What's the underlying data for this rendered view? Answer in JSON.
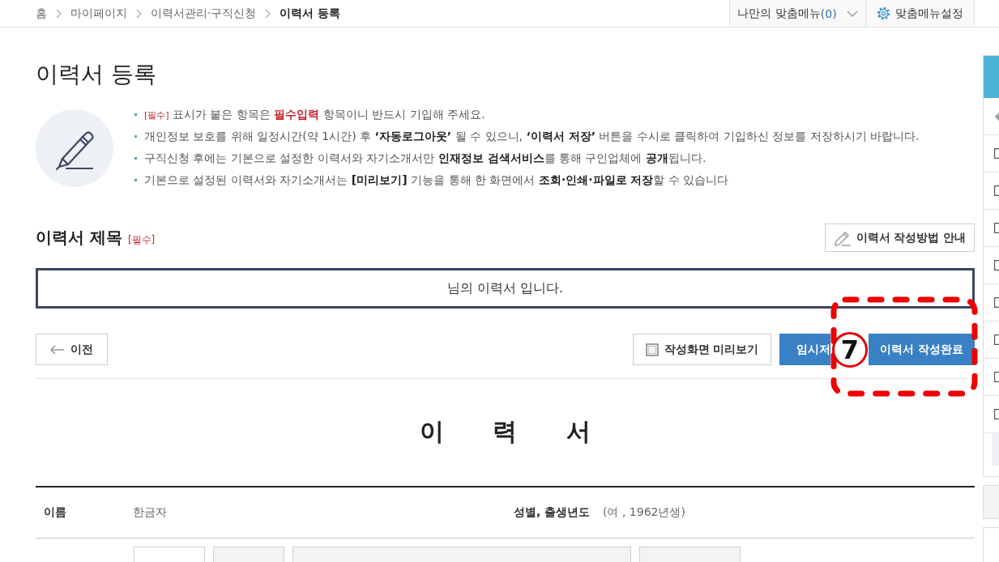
{
  "breadcrumb": [
    {
      "label": "홈",
      "current": false
    },
    {
      "label": "마이페이지",
      "current": false
    },
    {
      "label": "이력서관리·구직신청",
      "current": false
    },
    {
      "label": "이력서 등록",
      "current": true
    }
  ],
  "top_menu": {
    "my_menu": {
      "label": "나만의 맞춤메뉴",
      "count": "(0)"
    },
    "settings": "맞춤메뉴설정"
  },
  "page_title": "이력서 등록",
  "notices": [
    {
      "kind": "required",
      "tag": "[필수]",
      "text": "표시가 붙은 항목은 **필수입력** 항목이니 반드시 기입해 주세요."
    },
    {
      "kind": "info",
      "text": "개인정보 보호를 위해 일정시간(약 1시간) 후 **‘자동로그아웃’** 될 수 있으니, **‘이력서 저장’** 버튼을 수시로 클릭하여 기입하신 정보를 저장하시기 바랍니다."
    },
    {
      "kind": "info",
      "text": "구직신청 후에는 기본으로 설정한 이력서와 자기소개서만 **인재정보 검색서비스**를 통해 구인업체에 **공개**됩니다."
    },
    {
      "kind": "info",
      "text": "기본으로 설정된 이력서와 자기소개서는 **[미리보기]** 기능을 통해 한 화면에서 **조회·인쇄·파일로 저장**할 수 있습니다"
    }
  ],
  "title_section": {
    "heading": "이력서 제목",
    "tag": "[필수]",
    "guide_button": "이력서 작성방법 안내",
    "value": "님의 이력서 입니다."
  },
  "actions": {
    "back": "이전",
    "preview": "작성화면 미리보기",
    "temp_save": "임시저",
    "complete": "이력서 작성완료"
  },
  "callout": {
    "number": "7"
  },
  "resume": {
    "heading": "이 력 서",
    "fields": [
      {
        "label": "이름",
        "value": "한금자"
      },
      {
        "label": "성별, 출생년도",
        "value": "(여 , 1962년생)"
      }
    ]
  },
  "quick_menu": {
    "items": [
      {
        "kind": "icon"
      },
      {
        "kind": "checkbox",
        "checked": false
      },
      {
        "kind": "checkbox",
        "checked": false
      },
      {
        "kind": "checkbox",
        "checked": false
      },
      {
        "kind": "checkbox",
        "checked": false
      },
      {
        "kind": "checkbox",
        "checked": false
      },
      {
        "kind": "checkbox",
        "checked": false
      },
      {
        "kind": "checkbox",
        "checked": false
      },
      {
        "kind": "checkbox",
        "checked": false
      }
    ]
  }
}
